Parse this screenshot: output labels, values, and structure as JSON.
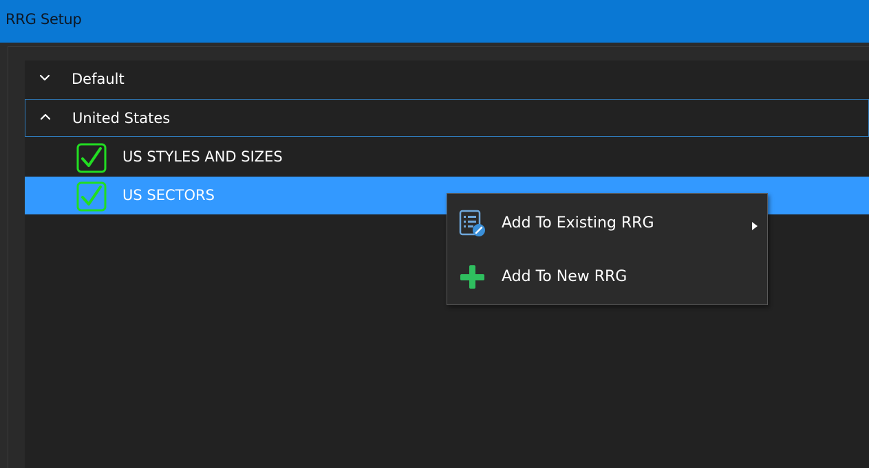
{
  "window": {
    "title": "RRG Setup"
  },
  "tree": {
    "groups": [
      {
        "label": "Default",
        "state": "collapsed",
        "chevron_icon": "chevron-down-icon"
      },
      {
        "label": "United States",
        "state": "expanded",
        "chevron_icon": "chevron-up-icon"
      }
    ],
    "items": [
      {
        "label": "US STYLES AND SIZES",
        "checked": true,
        "selected": false
      },
      {
        "label": "US SECTORS",
        "checked": true,
        "selected": true
      }
    ]
  },
  "context_menu": {
    "items": [
      {
        "label": "Add To Existing RRG",
        "icon": "list-edit-icon",
        "has_submenu": true
      },
      {
        "label": "Add To New RRG",
        "icon": "plus-icon",
        "has_submenu": false
      }
    ]
  },
  "colors": {
    "titlebar": "#0a78d4",
    "selection": "#3399ff",
    "checkbox": "#22dd22",
    "plus": "#2fbf5f"
  }
}
